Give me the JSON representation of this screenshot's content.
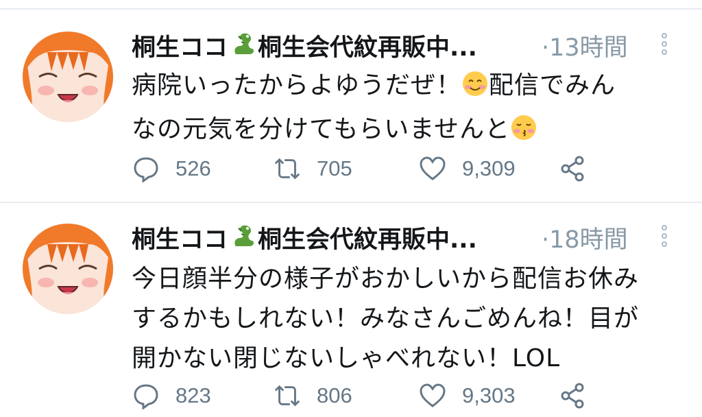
{
  "tweets": [
    {
      "name_part1": "桐生ココ",
      "name_part2": "桐生会代紋再販中...",
      "time": "·13時間",
      "text": {
        "l1a": "病院いったからよゆうだぜ！",
        "l1b": "配信でみん",
        "l2a": "なの元気を分けてもらいませんと"
      },
      "emojis": [
        "dragon-emoji",
        "smiling-face-emoji",
        "kissing-face-emoji"
      ],
      "replies": "526",
      "retweets": "705",
      "likes": "9,309"
    },
    {
      "name_part1": "桐生ココ",
      "name_part2": "桐生会代紋再販中...",
      "time": "·18時間",
      "text": {
        "l1": "今日顔半分の様子がおかしいから配信お休み",
        "l2": "するかもしれない！みなさんごめんね！目が",
        "l3": "開かない閉じないしゃべれない！LOL"
      },
      "emojis": [
        "dragon-emoji"
      ],
      "replies": "823",
      "retweets": "806",
      "likes": "9,303"
    }
  ],
  "colors": {
    "icon": "#657786",
    "muted": "#8899a6",
    "divider": "#e6ecf0"
  }
}
